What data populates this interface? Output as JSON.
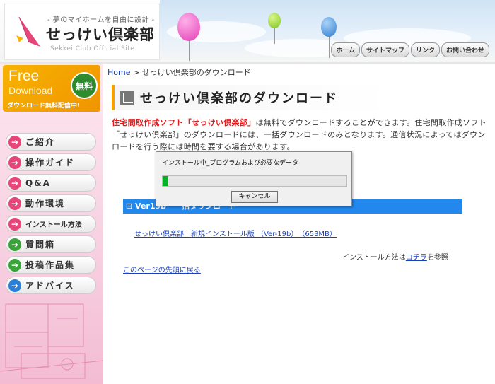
{
  "header": {
    "tagline": "- 夢のマイホームを自由に設計 -",
    "logo_title": "せっけい倶楽部",
    "logo_sub": "Sekkei Club Official Site",
    "nav": [
      "ホーム",
      "サイトマップ",
      "リンク",
      "お問い合わせ"
    ]
  },
  "sidebar": {
    "free_big": "Free",
    "free_download": "Download",
    "free_badge": "無料",
    "free_note": "ダウンロード無料配信中!",
    "menu": [
      {
        "label": "ご紹介",
        "color": "#e8457a",
        "icon": "arrow-right-icon"
      },
      {
        "label": "操作ガイド",
        "color": "#e8457a",
        "icon": "arrow-right-icon"
      },
      {
        "label": "Q&A",
        "color": "#e8457a",
        "icon": "arrow-right-icon"
      },
      {
        "label": "動作環境",
        "color": "#e8457a",
        "icon": "arrow-right-icon"
      },
      {
        "label": "インストール方法",
        "color": "#e8457a",
        "icon": "arrow-right-icon"
      },
      {
        "label": "質問箱",
        "color": "#3aa43a",
        "icon": "arrow-right-icon"
      },
      {
        "label": "投稿作品集",
        "color": "#3aa43a",
        "icon": "arrow-right-icon"
      },
      {
        "label": "アドバイス",
        "color": "#2a7fd8",
        "icon": "arrow-right-icon"
      }
    ]
  },
  "main": {
    "breadcrumb_home": "Home",
    "breadcrumb_sep": " > ",
    "breadcrumb_current": "せっけい倶楽部のダウンロード",
    "page_title": "せっけい倶楽部のダウンロード",
    "intro_highlight": "住宅間取作成ソフト「せっけい倶楽部」",
    "intro_rest": "は無料でダウンロードすることができます。住宅間取作成ソフト「せっけい倶楽部」のダウンロードには、一括ダウンロードのみとなります。通信状況によってはダウンロードを行う際には時間を要する場合があります。",
    "download_header": "⊟ Ver19b　一括ダウンロード",
    "download_link": "せっけい倶楽部　新規インストール版 （Ver-19b）　（653MB）",
    "install_note_prefix": "インストール方法は",
    "install_note_link": "コチラ",
    "install_note_suffix": "を参照",
    "top_link": "このページの先頭に戻る"
  },
  "dialog": {
    "message": "インストール中_プログラムおよび必要なデータ",
    "progress_percent": 3,
    "cancel_label": "キャンセル"
  }
}
